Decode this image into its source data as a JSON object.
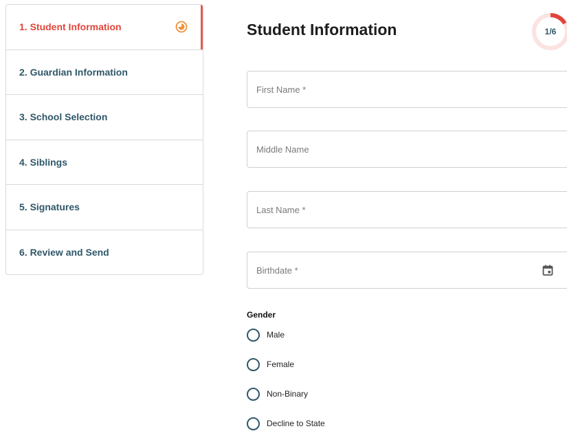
{
  "sidebar": {
    "items": [
      {
        "label": "1. Student Information",
        "active": true
      },
      {
        "label": "2. Guardian Information",
        "active": false
      },
      {
        "label": "3. School Selection",
        "active": false
      },
      {
        "label": "4. Siblings",
        "active": false
      },
      {
        "label": "5. Signatures",
        "active": false
      },
      {
        "label": "6. Review and Send",
        "active": false
      }
    ]
  },
  "main": {
    "title": "Student Information",
    "progress": {
      "text": "1/6",
      "fraction": 0.1667
    },
    "fields": {
      "first_name": {
        "placeholder": "First Name *",
        "value": ""
      },
      "middle_name": {
        "placeholder": "Middle Name",
        "value": ""
      },
      "last_name": {
        "placeholder": "Last Name *",
        "value": ""
      },
      "birthdate": {
        "placeholder": "Birthdate *",
        "value": ""
      }
    },
    "gender": {
      "label": "Gender",
      "options": [
        "Male",
        "Female",
        "Non-Binary",
        "Decline to State"
      ]
    }
  },
  "colors": {
    "accent": "#e0453a",
    "nav_text": "#2f5769",
    "in_progress_icon": "#f0913a"
  },
  "icons": {
    "active_step": "in-progress-icon",
    "birthdate": "calendar-icon"
  }
}
